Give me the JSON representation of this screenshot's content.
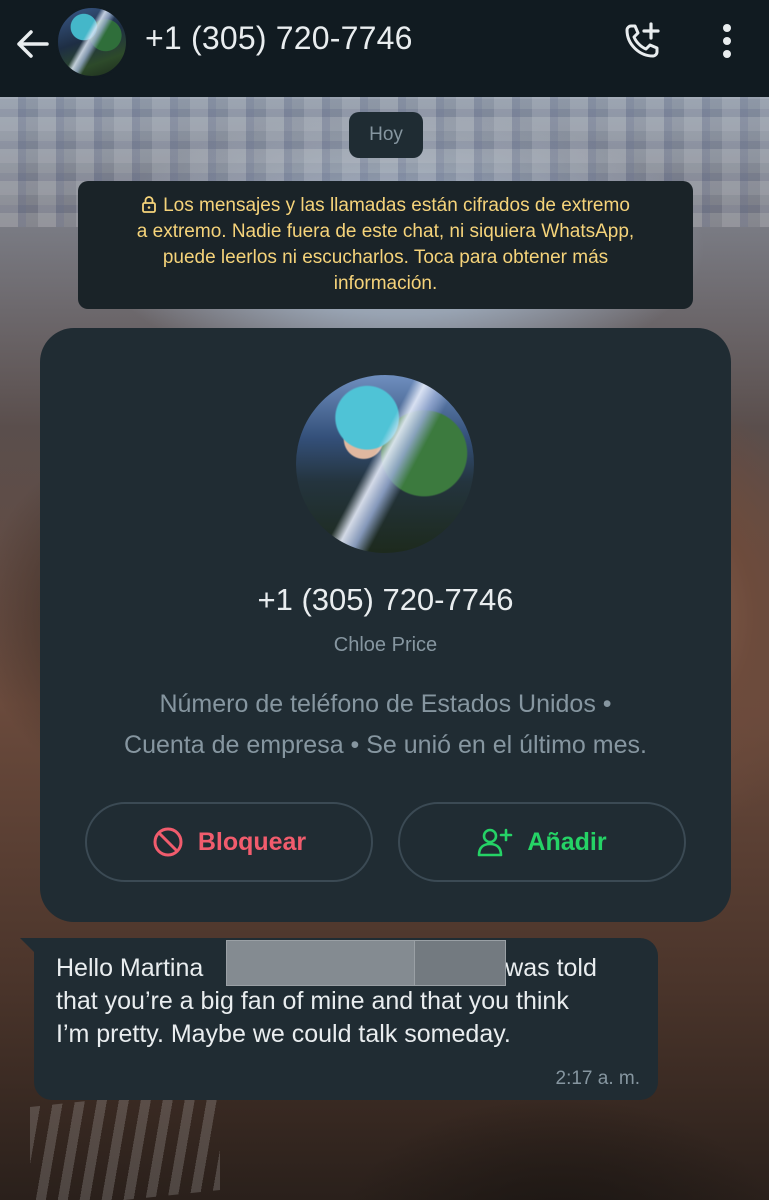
{
  "header": {
    "title": "+1 (305) 720-7746",
    "background": "#111b21"
  },
  "date_chip": "Hoy",
  "encryption_notice": {
    "line1": "Los mensajes y las llamadas están cifrados de extremo",
    "line2": "a extremo. Nadie fuera de este chat, ni siquiera WhatsApp,",
    "line3": "puede leerlos ni escucharlos. Toca para obtener más",
    "line4": "información.",
    "color": "#f5d37a"
  },
  "contact_card": {
    "number": "+1 (305) 720-7746",
    "name": "Chloe Price",
    "info_line1": "Número de teléfono de Estados Unidos •",
    "info_line2": "Cuenta de empresa • Se unió en el último mes.",
    "block_label": "Bloquear",
    "add_label": "Añadir",
    "block_color": "#f15c6d",
    "add_color": "#25d366"
  },
  "message": {
    "line1_start": "Hello Martina",
    "line1_end": "I was told",
    "line2": "that you’re a big fan of mine and that you think",
    "line3": "I’m pretty. Maybe we could talk someday.",
    "time": "2:17 a. m."
  },
  "icons": {
    "back": "arrow-left-icon",
    "call": "add-call-icon",
    "menu": "more-vertical-icon",
    "lock": "lock-icon",
    "block": "block-icon",
    "add": "add-person-icon"
  }
}
